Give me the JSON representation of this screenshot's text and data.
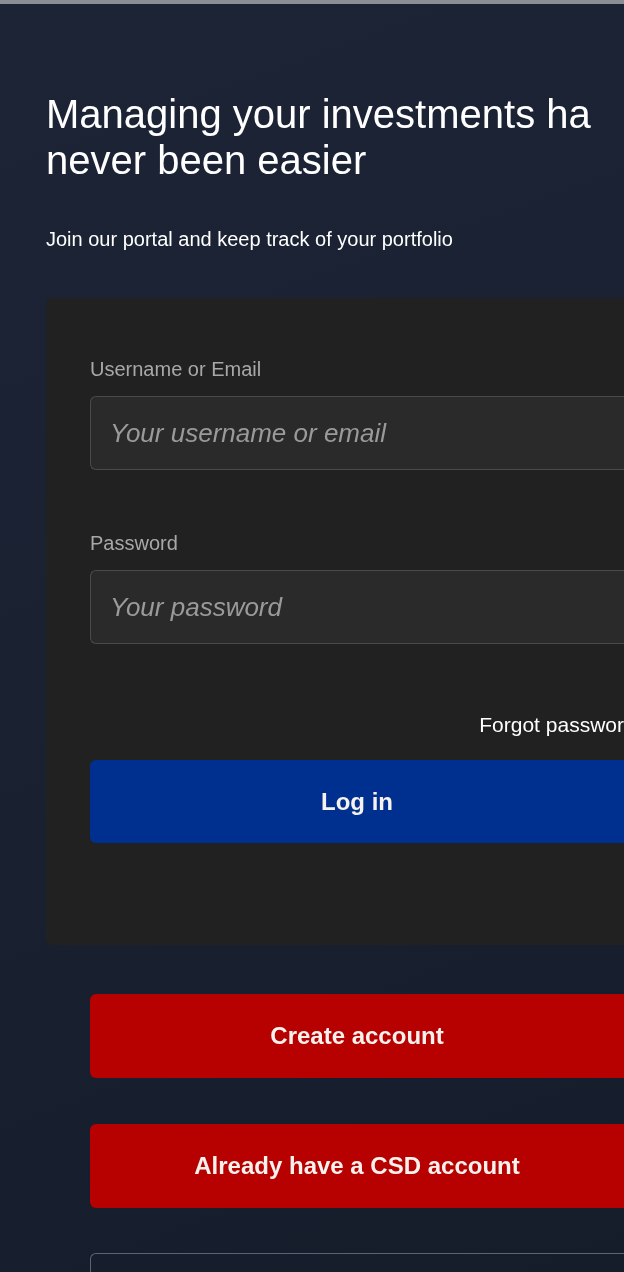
{
  "heading": {
    "lines": [
      "Managing your investments ha",
      "never been easier"
    ]
  },
  "subtitle": "Join our portal and keep track of your portfolio",
  "login_form": {
    "fields": [
      {
        "label": "Username or Email",
        "placeholder": "Your username or email"
      },
      {
        "label": "Password",
        "placeholder": "Your password"
      }
    ],
    "forgot_link": "Forgot passwor",
    "submit": "Log in"
  },
  "actions": [
    "Create account",
    "Already have a CSD account"
  ]
}
